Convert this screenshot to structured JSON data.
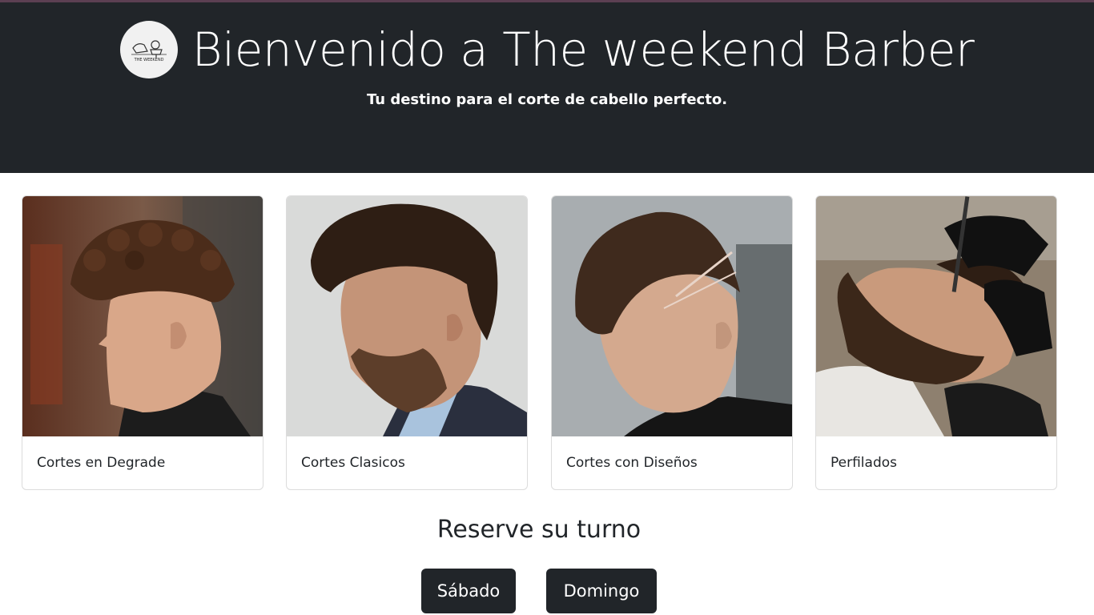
{
  "header": {
    "logo_text": "THE WEEKEND",
    "title": "Bienvenido a The weekend Barber",
    "subtitle": "Tu destino para el corte de cabello perfecto."
  },
  "services": [
    {
      "label": "Cortes en Degrade",
      "image": "profile-curly-fade-photo"
    },
    {
      "label": "Cortes Clasicos",
      "image": "classic-cut-beard-photo"
    },
    {
      "label": "Cortes con Diseños",
      "image": "design-line-cut-photo"
    },
    {
      "label": "Perfilados",
      "image": "beard-trim-barber-photo"
    }
  ],
  "reserve": {
    "title": "Reserve su turno",
    "buttons": [
      "Sábado",
      "Domingo"
    ]
  },
  "colors": {
    "header_bg": "#212529",
    "button_bg": "#212529",
    "text": "#212529",
    "card_border": "#dcdcdc"
  }
}
